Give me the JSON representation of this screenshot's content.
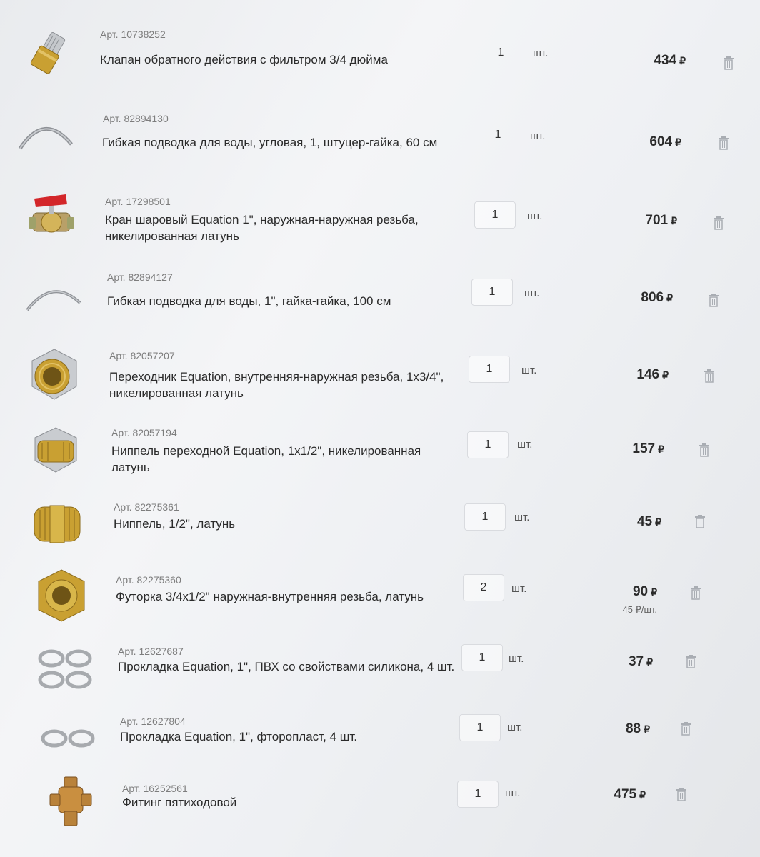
{
  "currency_symbol": "₽",
  "items": [
    {
      "sku": "Арт. 10738252",
      "name": "Клапан обратного действия с фильтром 3/4 дюйма",
      "qty": "1",
      "unit": "шт.",
      "price": "434",
      "per_unit": ""
    },
    {
      "sku": "Арт. 82894130",
      "name": "Гибкая подводка для воды, угловая, 1, штуцер-гайка, 60 см",
      "qty": "1",
      "unit": "шт.",
      "price": "604",
      "per_unit": ""
    },
    {
      "sku": "Арт. 17298501",
      "name": "Кран шаровый Equation 1\", наружная-наружная резьба, никелированная латунь",
      "qty": "1",
      "unit": "шт.",
      "price": "701",
      "per_unit": ""
    },
    {
      "sku": "Арт. 82894127",
      "name": "Гибкая подводка для воды, 1\", гайка-гайка, 100 см",
      "qty": "1",
      "unit": "шт.",
      "price": "806",
      "per_unit": ""
    },
    {
      "sku": "Арт. 82057207",
      "name": "Переходник Equation, внутренняя-наружная резьба, 1x3/4\", никелированная латунь",
      "qty": "1",
      "unit": "шт.",
      "price": "146",
      "per_unit": ""
    },
    {
      "sku": "Арт. 82057194",
      "name": "Ниппель переходной Equation, 1x1/2\", никелированная латунь",
      "qty": "1",
      "unit": "шт.",
      "price": "157",
      "per_unit": ""
    },
    {
      "sku": "Арт. 82275361",
      "name": "Ниппель, 1/2\", латунь",
      "qty": "1",
      "unit": "шт.",
      "price": "45",
      "per_unit": ""
    },
    {
      "sku": "Арт. 82275360",
      "name": "Футорка 3/4x1/2\" наружная-внутренняя резьба, латунь",
      "qty": "2",
      "unit": "шт.",
      "price": "90",
      "per_unit": "45 ₽/шт."
    },
    {
      "sku": "Арт. 12627687",
      "name": "Прокладка Equation, 1\", ПВХ со свойствами силикона, 4 шт.",
      "qty": "1",
      "unit": "шт.",
      "price": "37",
      "per_unit": ""
    },
    {
      "sku": "Арт. 12627804",
      "name": "Прокладка Equation, 1\", фторопласт, 4 шт.",
      "qty": "1",
      "unit": "шт.",
      "price": "88",
      "per_unit": ""
    },
    {
      "sku": "Арт. 16252561",
      "name": "Фитинг пятиходовой",
      "qty": "1",
      "unit": "шт.",
      "price": "475",
      "per_unit": ""
    }
  ],
  "icons": [
    "check-valve-icon",
    "flex-hose-icon",
    "ball-valve-icon",
    "flex-hose-icon",
    "adapter-fitting-icon",
    "nipple-adapter-icon",
    "nipple-icon",
    "bushing-icon",
    "gaskets-four-icon",
    "gaskets-two-icon",
    "five-way-fitting-icon",
    "trash-icon"
  ],
  "colors": {
    "brass": "#c9a032",
    "brass_dark": "#8a6a1c",
    "chrome": "#b9bcc0",
    "valve_red": "#d3262a",
    "trash": "#a9adb3"
  }
}
